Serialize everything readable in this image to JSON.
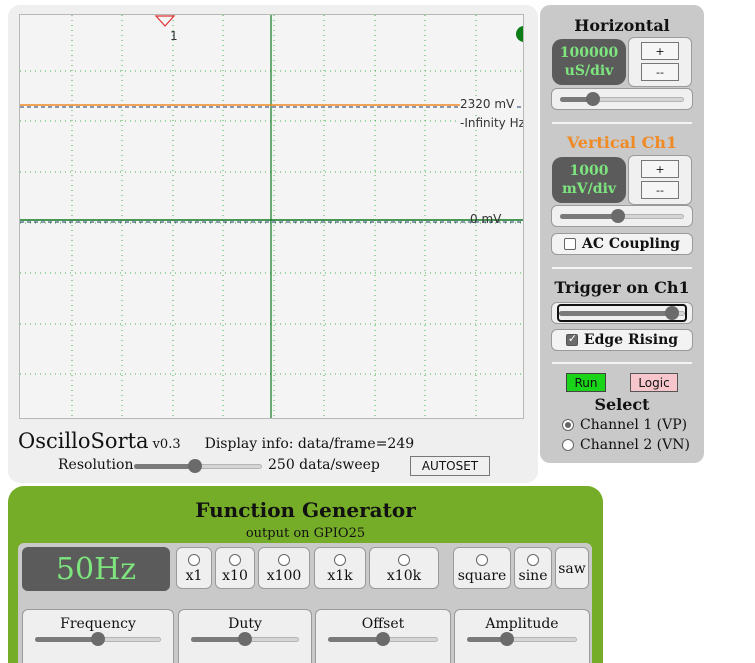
{
  "scope": {
    "channel1_label": "2320 mV",
    "frequency_label": "-Infinity Hz",
    "ground_label": "0 mV",
    "trigger_marker_label": "1",
    "colors": {
      "channel1": "#f08a24",
      "trace_dark": "#1e3a6e",
      "ground": "#0f7a1f",
      "axis": "#0f7a1f",
      "grid": "#49b049",
      "status_dot": "#0b7d17"
    }
  },
  "brand": {
    "name": "OscilloSorta",
    "version": "v0.3",
    "display_info": "Display info: data/frame=249"
  },
  "resolution": {
    "label": "Resolution",
    "value_text": "250 data/sweep",
    "slider_fraction": 0.48,
    "autoset_label": "AUTOSET"
  },
  "horizontal": {
    "title": "Horizontal",
    "value_line1": "100000",
    "value_line2": "uS/div",
    "plus_label": "+",
    "minus_label": "--",
    "slider_fraction": 0.27
  },
  "vertical": {
    "title": "Vertical Ch1",
    "title_color": "#f08a24",
    "value_line1": "1000",
    "value_line2": "mV/div",
    "plus_label": "+",
    "minus_label": "--",
    "slider_fraction": 0.47,
    "ac_coupling_label": "AC Coupling",
    "ac_coupling_checked": false
  },
  "trigger": {
    "title": "Trigger on Ch1",
    "slider_fraction": 0.9,
    "edge_label": "Edge Rising",
    "edge_checked": true
  },
  "run_label": "Run",
  "logic_label": "Logic",
  "select": {
    "title": "Select",
    "options": [
      {
        "label": "Channel 1 (VP)",
        "checked": true
      },
      {
        "label": "Channel 2 (VN)",
        "checked": false
      }
    ]
  },
  "function_generator": {
    "title": "Function Generator",
    "subtitle": "output on GPIO25",
    "frequency_display": "50Hz",
    "multipliers": [
      "x1",
      "x10",
      "x100",
      "x1k",
      "x10k"
    ],
    "waveforms": [
      "square",
      "sine",
      "saw"
    ],
    "knobs": [
      {
        "label": "Frequency",
        "fraction": 0.5
      },
      {
        "label": "Duty",
        "fraction": 0.5
      },
      {
        "label": "Offset",
        "fraction": 0.5
      },
      {
        "label": "Amplitude",
        "fraction": 0.36
      }
    ]
  }
}
